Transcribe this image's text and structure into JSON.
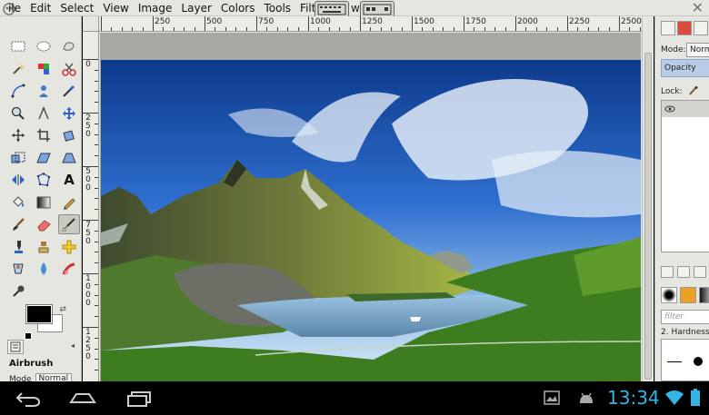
{
  "menubar": {
    "items": [
      "ile",
      "Edit",
      "Select",
      "View",
      "Image",
      "Layer",
      "Colors",
      "Tools",
      "Filters"
    ],
    "extra_label": "w:"
  },
  "ruler": {
    "h_labels": [
      "250",
      "500",
      "750",
      "1000",
      "1250",
      "1500",
      "1750",
      "2000",
      "2250",
      "2500"
    ],
    "v_labels": [
      "0",
      "2 5 0",
      "5 0 0",
      "7 5 0",
      "1 0 0 0",
      "1 2 5 0"
    ]
  },
  "toolbox": {
    "tool_name": "Airbrush",
    "mode_label": "Mode",
    "mode_value": "Normal"
  },
  "dock": {
    "mode_label": "Mode:",
    "mode_value": "Norm",
    "opacity_label": "Opacity",
    "lock_label": "Lock:",
    "filter_placeholder": "filter",
    "hardness_label": "2. Hardness"
  },
  "status": {
    "time": "13:34"
  },
  "colors": {
    "foreground": "#000000",
    "background": "#ffffff",
    "clock_accent": "#33b5e5"
  }
}
